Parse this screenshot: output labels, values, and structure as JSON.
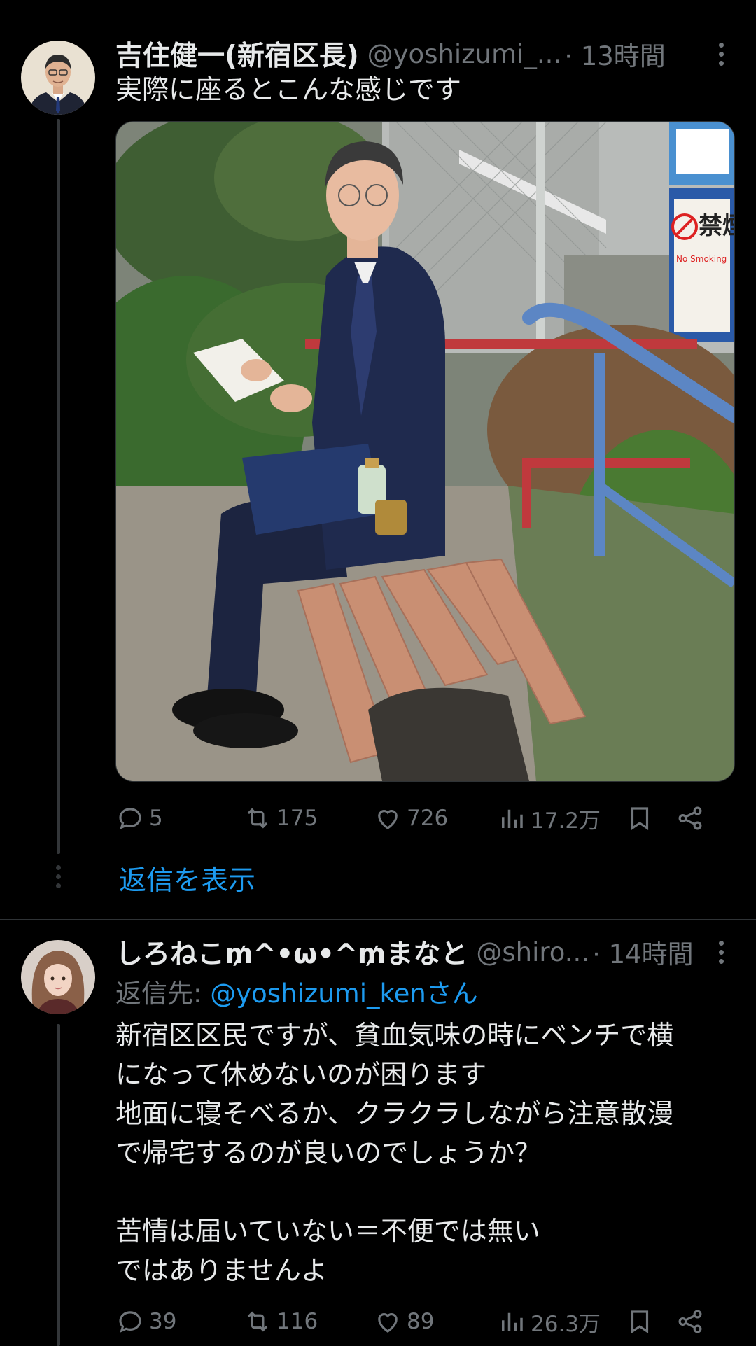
{
  "tweet1": {
    "name": "吉住健一(新宿区長)",
    "handle": "@yoshizumi_...",
    "time": "· 13時間",
    "text": "実際に座るとこんな感じです",
    "photo_sign_main": "禁煙",
    "photo_sign_sub": "No Smoking",
    "stats": {
      "replies": "5",
      "retweets": "175",
      "likes": "726",
      "views": "17.2万"
    }
  },
  "show_replies": "返信を表示",
  "tweet2": {
    "name": "しろねこ₥^•ω•^₥まなと",
    "handle": "@shiro...",
    "time": "· 14時間",
    "replying_prefix": "返信先: ",
    "replying_mention": "@yoshizumi_kenさん",
    "text": "新宿区区民ですが、貧血気味の時にベンチで横\nになって休めないのが困ります\n地面に寝そべるか、クラクラしながら注意散漫\nで帰宅するのが良いのでしょうか？\n\n苦情は届いていない＝不便では無い\nではありませんよ",
    "stats": {
      "replies": "39",
      "retweets": "116",
      "likes": "89",
      "views": "26.3万"
    }
  },
  "colors": {
    "accent": "#1d9bf0",
    "muted": "#71767b",
    "text": "#e7e9ea",
    "bg": "#000000"
  },
  "icons": [
    "reply-icon",
    "retweet-icon",
    "like-icon",
    "views-icon",
    "bookmark-icon",
    "share-icon",
    "more-icon"
  ]
}
